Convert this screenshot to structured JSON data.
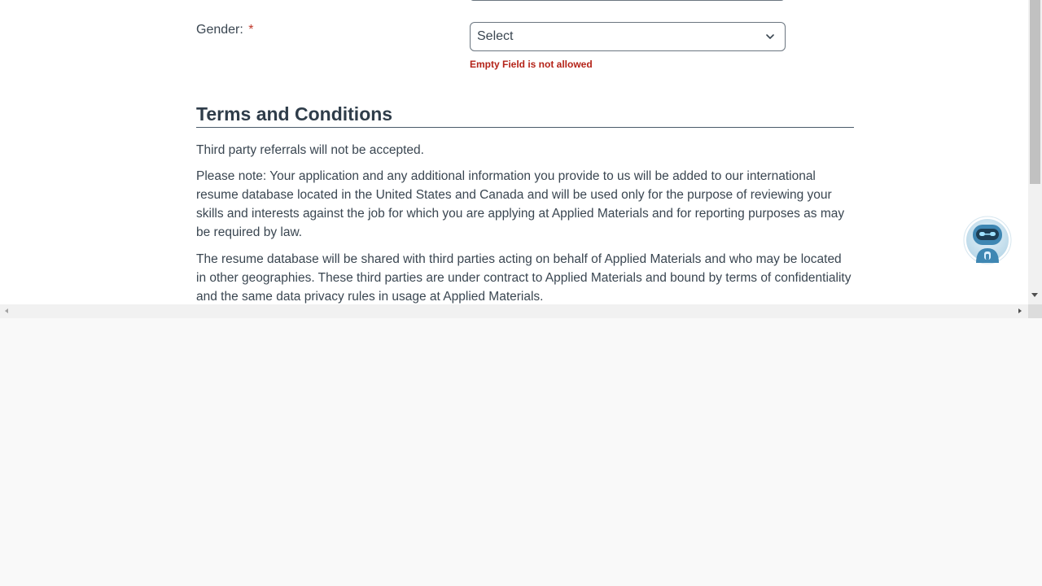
{
  "form": {
    "gender": {
      "label": "Gender:",
      "required_mark": "*",
      "select_value": "Select",
      "error": "Empty Field is not allowed"
    }
  },
  "terms": {
    "title": "Terms and Conditions",
    "paragraphs": [
      "Third party referrals will not be accepted.",
      "Please note: Your application and any additional information you provide to us will be added to our international resume database located in the United States and Canada and will be used only for the purpose of reviewing your skills and interests against the job for which you are applying at Applied Materials and for reporting purposes as may be required by law.",
      "The resume database will be shared with third parties acting on behalf of Applied Materials and who may be located in other geographies. These third parties are under contract to Applied Materials and bound by terms of confidentiality and the same data privacy rules in usage at Applied Materials."
    ]
  },
  "chatbot": {
    "icon": "robot-icon"
  },
  "colors": {
    "error": "#b42318",
    "heading": "#2f3d4a",
    "text": "#3a4651",
    "bot": "#4a90b8"
  }
}
